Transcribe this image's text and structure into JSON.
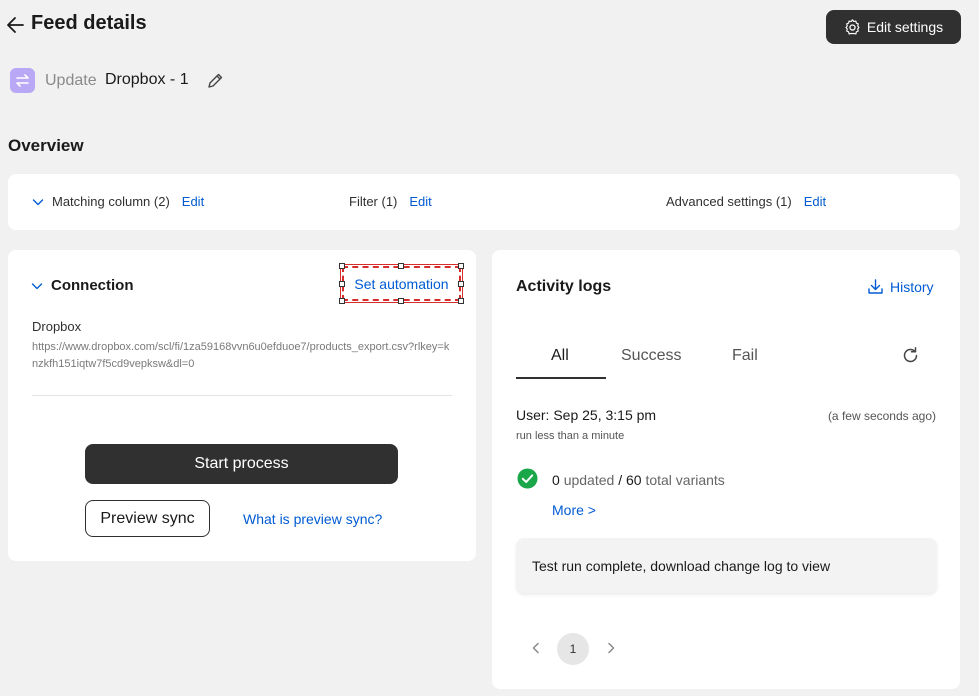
{
  "header": {
    "title": "Feed details",
    "edit_settings_label": "Edit settings"
  },
  "feed": {
    "type_label": "Update",
    "name": "Dropbox - 1"
  },
  "overview": {
    "title": "Overview",
    "matching_column_label": "Matching column (2)",
    "filter_label": "Filter (1)",
    "advanced_settings_label": "Advanced settings (1)",
    "edit_label": "Edit"
  },
  "connection": {
    "title": "Connection",
    "set_automation_label": "Set automation",
    "source_name": "Dropbox",
    "source_url": "https://www.dropbox.com/scl/fi/1za59168vvn6u0efduoe7/products_export.csv?rlkey=knzkfh151iqtw7f5cd9vepksw&dl=0",
    "start_process_label": "Start process",
    "preview_sync_label": "Preview sync",
    "preview_help_label": "What is preview sync?"
  },
  "activity_logs": {
    "title": "Activity logs",
    "history_label": "History",
    "tabs": [
      {
        "label": "All",
        "active": true
      },
      {
        "label": "Success",
        "active": false
      },
      {
        "label": "Fail",
        "active": false
      }
    ],
    "entry": {
      "user_line": "User:  Sep 25, 3:15 pm",
      "relative_time": "(a few seconds ago)",
      "duration": "run less than a minute",
      "updated_count": "0",
      "updated_label": "updated",
      "separator": "/",
      "total_count": "60",
      "total_label": "total variants",
      "more_label": "More >",
      "message": "Test run complete, download change log to view"
    },
    "pagination": {
      "current_page": "1"
    }
  },
  "colors": {
    "accent_link": "#005bd3",
    "primary_button": "#303030",
    "success": "#1aa74a",
    "feed_icon": "#b8a8f5",
    "highlight_box": "#d72c2c"
  },
  "icons": {
    "back": "arrow-left-icon",
    "settings": "gear-icon",
    "feed_type": "sync-arrows-icon",
    "edit_name": "pencil-icon",
    "collapse": "chevron-down-icon",
    "history": "download-icon",
    "refresh": "refresh-icon",
    "status": "check-circle-icon",
    "prev": "chevron-left-icon",
    "next": "chevron-right-icon"
  }
}
